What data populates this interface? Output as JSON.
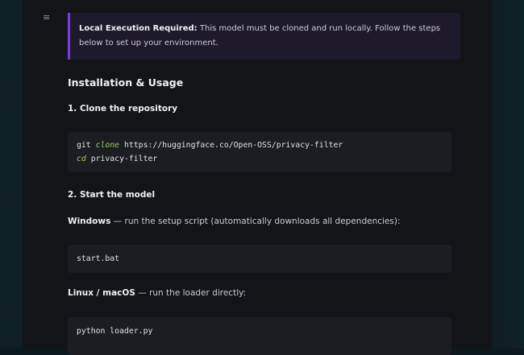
{
  "callout": {
    "bold": "Local Execution Required:",
    "text": " This model must be cloned and run locally. Follow the steps below to set up your environment."
  },
  "section_title": "Installation & Usage",
  "step1": {
    "title": "1. Clone the repository",
    "line1_prefix": "git ",
    "line1_kw": "clone",
    "line1_rest": " https://huggingface.co/Open-OSS/privacy-filter",
    "line2_kw": "cd",
    "line2_rest": " privacy-filter"
  },
  "step2": {
    "title": "2. Start the model",
    "windows_bold": "Windows",
    "windows_text": " — run the setup script (automatically downloads all dependencies):",
    "windows_code": "start.bat",
    "linux_bold": "Linux / macOS",
    "linux_text": " — run the loader directly:",
    "linux_code": "python loader.py"
  },
  "icons": {
    "menu": "menu-icon"
  }
}
